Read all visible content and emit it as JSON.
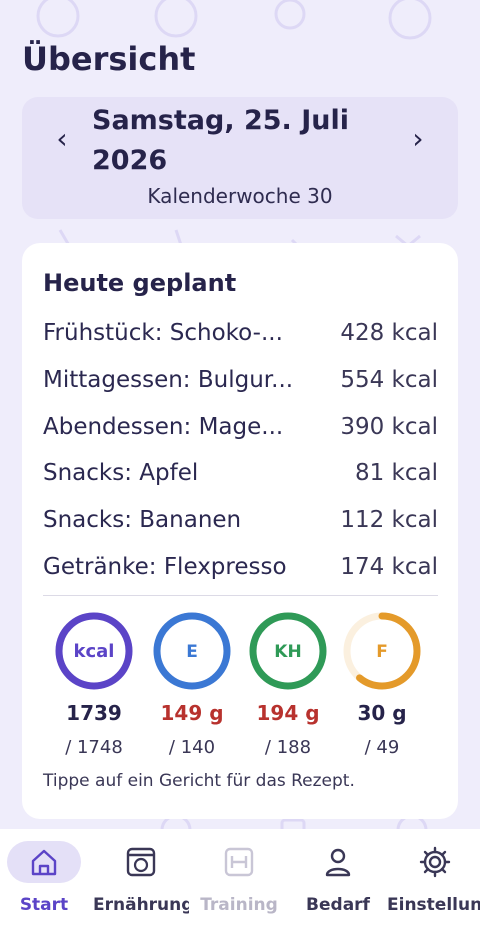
{
  "header": {
    "title": "Übersicht"
  },
  "date_selector": {
    "date": "Samstag, 25. Juli 2026",
    "week": "Kalenderwoche 30",
    "prev_icon": "chevron-left-icon",
    "next_icon": "chevron-right-icon"
  },
  "plan": {
    "title": "Heute geplant",
    "meals": [
      {
        "name": "Frühstück: Schoko-...",
        "kcal": "428 kcal"
      },
      {
        "name": "Mittagessen: Bulgur...",
        "kcal": "554 kcal"
      },
      {
        "name": "Abendessen: Mage...",
        "kcal": "390 kcal"
      },
      {
        "name": "Snacks: Apfel",
        "kcal": "81 kcal"
      },
      {
        "name": "Snacks: Bananen",
        "kcal": "112 kcal"
      },
      {
        "name": "Getränke: Flexpresso",
        "kcal": "174 kcal"
      }
    ],
    "macros": [
      {
        "label": "kcal",
        "value": "1739",
        "target": "/ 1748",
        "fraction": 0.995,
        "color": "#5b44c7",
        "over": false
      },
      {
        "label": "E",
        "value": "149 g",
        "target": "/ 140",
        "fraction": 1.0,
        "color": "#3b78d4",
        "over": true
      },
      {
        "label": "KH",
        "value": "194 g",
        "target": "/ 188",
        "fraction": 1.0,
        "color": "#2f9a57",
        "over": true
      },
      {
        "label": "F",
        "value": "30 g",
        "target": "/ 49",
        "fraction": 0.61,
        "color": "#e49a2a",
        "over": false
      }
    ],
    "hint": "Tippe auf ein Gericht für das Rezept."
  },
  "tabbar": {
    "tabs": [
      {
        "label": "Start",
        "icon": "home-icon",
        "active": true
      },
      {
        "label": "Ernährung",
        "icon": "nutrition-icon",
        "active": false
      },
      {
        "label": "Training",
        "icon": "dumbbell-icon",
        "active": false,
        "disabled": true
      },
      {
        "label": "Bedarf",
        "icon": "person-icon",
        "active": false
      },
      {
        "label": "Einstellungen",
        "icon": "gear-icon",
        "active": false
      }
    ]
  },
  "colors": {
    "accent": "#5b44c7",
    "background": "#efedfb",
    "over_target": "#b8322e"
  }
}
